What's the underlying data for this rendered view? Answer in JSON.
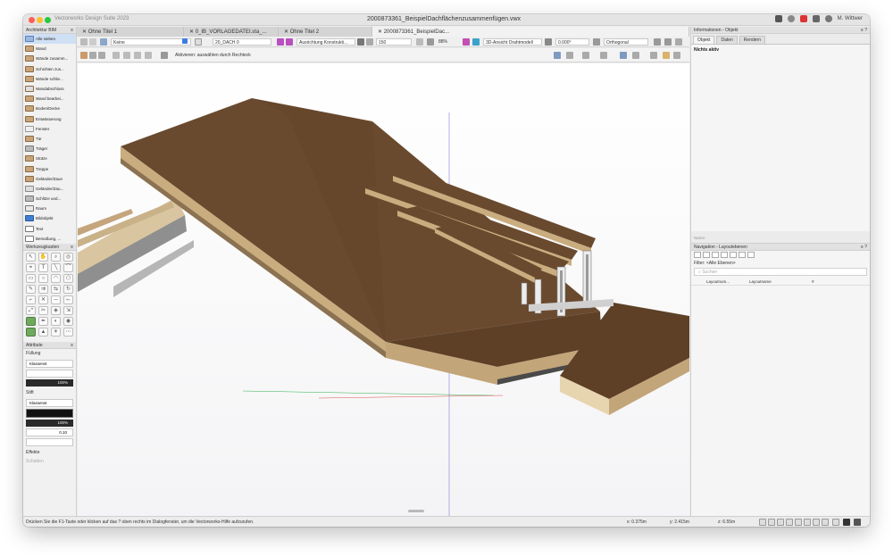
{
  "window": {
    "app_title": "Vectorworks Design Suite 2023",
    "doc_title": "2000873361_BeispielDachflächenzusammenfügen.vwx",
    "user": "M. Wittwer"
  },
  "tabs": [
    {
      "label": "Ohne Titel 1"
    },
    {
      "label": "0_IB_VORLAGEDATEI.sta_..."
    },
    {
      "label": "Ohne Titel 2"
    },
    {
      "label": "2000873361_BeispielDac..."
    }
  ],
  "toolbar1": {
    "class_field": "Keine",
    "layer_field": "20_DACH 0",
    "view_field": "Ausrichtung Konstrukti...",
    "scale_field": "150",
    "zoom_field": "88%",
    "render_field": "3D-Ansicht Drahtmodell",
    "angle_field": "0.000°",
    "projection_field": "Orthogonal"
  },
  "toolbar2": {
    "mode_hint": "Aktivieren: auswählen durch Rechteck"
  },
  "left_palette": {
    "title": "Architektur BIM",
    "items": [
      {
        "label": "Alle sieben"
      },
      {
        "label": "Wand"
      },
      {
        "label": "Wände zusamm..."
      },
      {
        "label": "Schichten zus..."
      },
      {
        "label": "Wände schlie..."
      },
      {
        "label": "Wandabschluss"
      },
      {
        "label": "Wand bearbei..."
      },
      {
        "label": "Boden/Decke"
      },
      {
        "label": "Entwässerung"
      },
      {
        "label": "Fenster"
      },
      {
        "label": "Tür"
      },
      {
        "label": "Träger"
      },
      {
        "label": "Stütze"
      },
      {
        "label": "Treppe"
      },
      {
        "label": "Geländer/Zaun"
      },
      {
        "label": "Geländer/Zau..."
      },
      {
        "label": "Schlitze und..."
      },
      {
        "label": "Raum"
      },
      {
        "label": "Bildobjekt"
      },
      {
        "label": "Text"
      },
      {
        "label": "Bemaßung, ..."
      }
    ]
  },
  "tools_palette": {
    "title": "Werkzeugkasten"
  },
  "attributes": {
    "title": "Attribute",
    "fill_label": "Füllung",
    "fill_class": "Klassenst",
    "fill_pct": "100%",
    "pen_label": "Stift",
    "pen_class": "Klassenst",
    "pen_pct": "100%",
    "line_weight": "0.10",
    "effects_label": "Effekte",
    "shadow_label": "Schatten"
  },
  "info_panel": {
    "title": "Informationen - Objekt",
    "tabs": [
      {
        "label": "Objekt"
      },
      {
        "label": "Daten"
      },
      {
        "label": "Rendern"
      }
    ],
    "body": "Nichts aktiv",
    "name_label": "Name:"
  },
  "nav_panel": {
    "title": "Navigation - Layoutebenen",
    "filter": "Filter: <Alle Ebenen>",
    "search_placeholder": "Suchen",
    "col1": "Layoutnum...",
    "col2": "Layoutname"
  },
  "statusbar": {
    "message": "Drücken Sie die F1-Taste oder klicken auf das ? oben rechts im Dialogfenster, um die Vectorworks-Hilfe aufzurufen.",
    "x": "x: 0.375m",
    "y": "y: 2.415m",
    "z": "z: 6.55m"
  }
}
